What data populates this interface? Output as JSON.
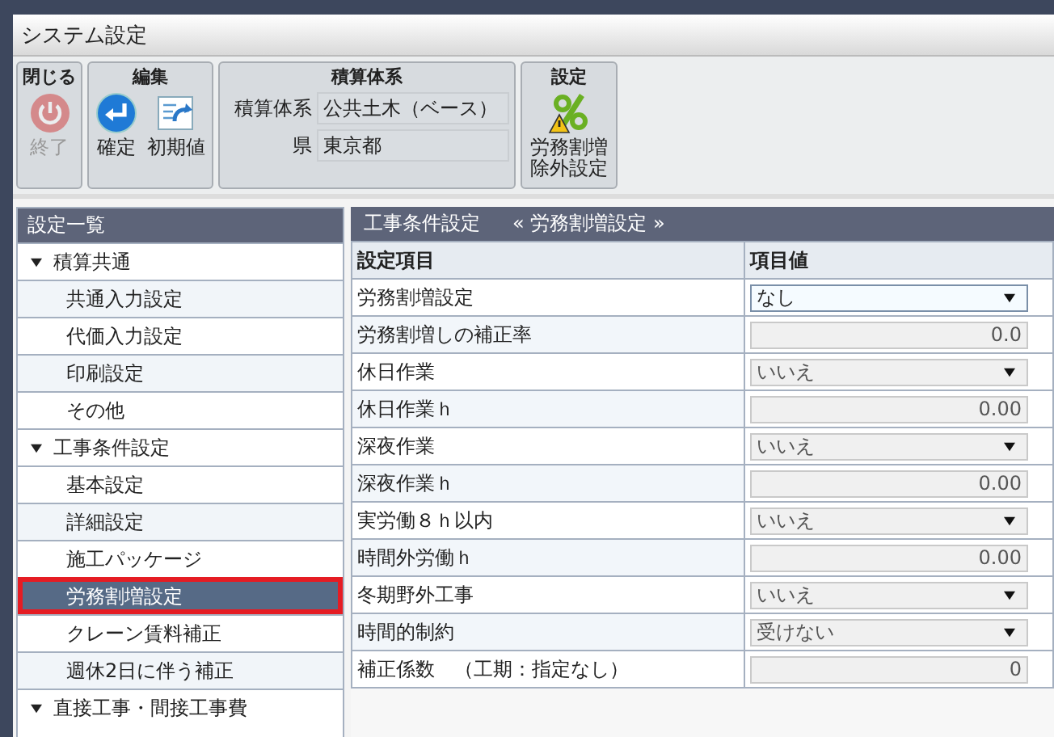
{
  "window": {
    "title": "システム設定"
  },
  "toolbar": {
    "groups": [
      {
        "title": "閉じる",
        "kind": "buttons",
        "buttons": [
          {
            "label": "終了",
            "kind": "power",
            "disabled": true
          }
        ]
      },
      {
        "title": "編集",
        "kind": "buttons",
        "buttons": [
          {
            "label": "確定",
            "kind": "enter",
            "disabled": false
          },
          {
            "label": "初期値",
            "kind": "reset",
            "disabled": false
          }
        ]
      },
      {
        "title": "積算体系",
        "kind": "fields",
        "fields": [
          {
            "label": "積算体系",
            "value": "公共土木（ベース）"
          },
          {
            "label": "県",
            "value": "東京都"
          }
        ]
      },
      {
        "title": "設定",
        "kind": "buttons",
        "buttons": [
          {
            "label": "労務割増除外設定",
            "kind": "percent",
            "disabled": false
          }
        ]
      }
    ]
  },
  "sidebar": {
    "title": "設定一覧",
    "items": [
      {
        "label": "積算共通",
        "expanded": true,
        "children": [
          {
            "label": "共通入力設定",
            "selected": false
          },
          {
            "label": "代価入力設定",
            "selected": false
          },
          {
            "label": "印刷設定",
            "selected": false
          },
          {
            "label": "その他",
            "selected": false
          }
        ]
      },
      {
        "label": "工事条件設定",
        "expanded": true,
        "children": [
          {
            "label": "基本設定",
            "selected": false
          },
          {
            "label": "詳細設定",
            "selected": false
          },
          {
            "label": "施工パッケージ",
            "selected": false
          },
          {
            "label": "労務割増設定",
            "selected": true
          },
          {
            "label": "クレーン賃料補正",
            "selected": false
          },
          {
            "label": "週休2日に伴う補正",
            "selected": false
          }
        ]
      },
      {
        "label": "直接工事・間接工事費",
        "expanded": true
      }
    ]
  },
  "panel": {
    "title": "工事条件設定",
    "subtitle": "« 労務割増設定 »",
    "table": {
      "columns": [
        "設定項目",
        "項目値"
      ],
      "rows": [
        {
          "label": "労務割増設定",
          "kind": "select",
          "value": "なし",
          "disabled": false
        },
        {
          "label": "労務割増しの補正率",
          "kind": "number",
          "value": "0.0",
          "disabled": true
        },
        {
          "label": "休日作業",
          "kind": "select",
          "value": "いいえ",
          "disabled": true
        },
        {
          "label": "休日作業ｈ",
          "kind": "number",
          "value": "0.00",
          "disabled": true
        },
        {
          "label": "深夜作業",
          "kind": "select",
          "value": "いいえ",
          "disabled": true
        },
        {
          "label": "深夜作業ｈ",
          "kind": "number",
          "value": "0.00",
          "disabled": true
        },
        {
          "label": "実労働８ｈ以内",
          "kind": "select",
          "value": "いいえ",
          "disabled": true
        },
        {
          "label": "時間外労働ｈ",
          "kind": "number",
          "value": "0.00",
          "disabled": true
        },
        {
          "label": "冬期野外工事",
          "kind": "select",
          "value": "いいえ",
          "disabled": true
        },
        {
          "label": "時間的制約",
          "kind": "select",
          "value": "受けない",
          "disabled": true
        },
        {
          "label": "補正係数　（工期：指定なし）",
          "kind": "number",
          "value": "0",
          "disabled": true
        }
      ]
    }
  }
}
